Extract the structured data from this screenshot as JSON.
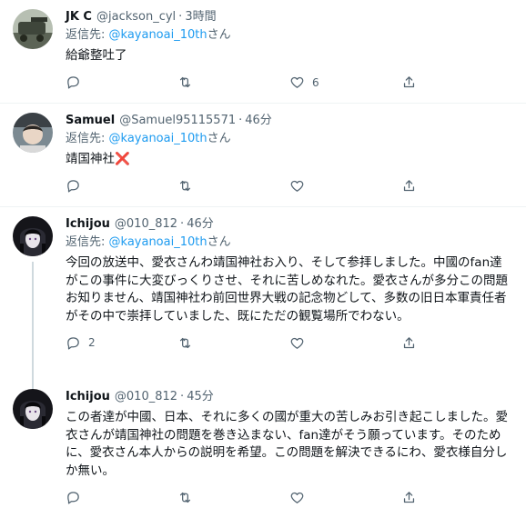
{
  "tweets": [
    {
      "name": "JK C",
      "handle": "@jackson_cyl",
      "time": "3時間",
      "reply_prefix": "返信先: ",
      "reply_to": "@kayanoai_10th",
      "reply_suffix": "さん",
      "text": "給爺整吐了",
      "reply_count": "",
      "retweet_count": "",
      "like_count": "6"
    },
    {
      "name": "Samuel",
      "handle": "@Samuel95115571",
      "time": "46分",
      "reply_prefix": "返信先: ",
      "reply_to": "@kayanoai_10th",
      "reply_suffix": "さん",
      "text": "靖国神社",
      "text_emoji": "❌",
      "reply_count": "",
      "retweet_count": "",
      "like_count": ""
    },
    {
      "name": "Ichijou",
      "handle": "@010_812",
      "time": "46分",
      "reply_prefix": "返信先: ",
      "reply_to": "@kayanoai_10th",
      "reply_suffix": "さん",
      "text": "今回の放送中、愛衣さんわ靖国神社お入り、そして参拝しました。中國のfan達がこの事件に大変びっくりさせ、それに苦しめなれた。愛衣さんが多分この問題お知りません、靖国神社わ前回世界大戦の記念物どして、多数の旧日本軍責任者がその中で崇拝していました、既にただの観覧場所でわない。",
      "reply_count": "2",
      "retweet_count": "",
      "like_count": ""
    },
    {
      "name": "Ichijou",
      "handle": "@010_812",
      "time": "45分",
      "text": "この者達が中國、日本、それに多くの國が重大の苦しみお引き起こしました。愛衣さんが靖国神社の問題を巻き込まない、fan達がそう願っています。そのために、愛衣さん本人からの説明を希望。この問題を解決できるにわ、愛衣様自分しか無い。",
      "reply_count": "",
      "retweet_count": "",
      "like_count": ""
    }
  ],
  "ui": {
    "dot": "·"
  },
  "colors": {
    "link": "#1d9bf0",
    "secondary_text": "#536471",
    "border": "#eff3f4"
  },
  "icons": [
    "reply-icon",
    "retweet-icon",
    "like-icon",
    "share-icon"
  ]
}
